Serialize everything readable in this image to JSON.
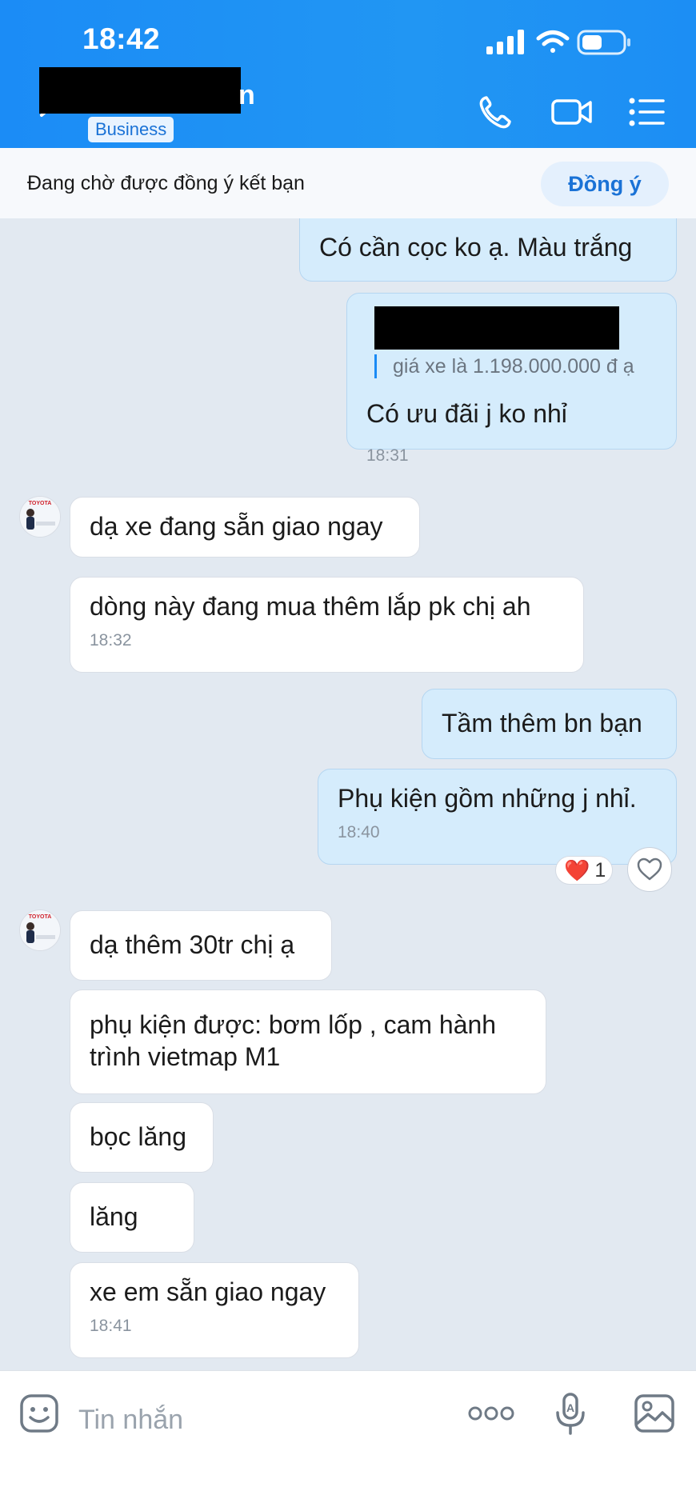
{
  "status_bar": {
    "time": "18:42"
  },
  "header": {
    "name_visible_tail": "n",
    "badge": "Business",
    "icons": [
      "phone-icon",
      "video-call-icon",
      "menu-list-icon"
    ],
    "background": "#2196f3"
  },
  "friend_request": {
    "text": "Đang chờ được đồng ý kết bạn",
    "accept_label": "Đồng ý"
  },
  "messages": [
    {
      "dir": "out",
      "text": "Có cần cọc ko ạ. Màu trắng",
      "time": ""
    },
    {
      "dir": "out",
      "quote": "giá xe là 1.198.000.000 đ ạ",
      "text": "Có ưu đãi j ko nhỉ",
      "time": "18:31"
    },
    {
      "dir": "in",
      "text": "dạ xe đang sẵn giao ngay",
      "time": ""
    },
    {
      "dir": "in",
      "text": "dòng này đang mua thêm lắp pk chị ah",
      "time": "18:32"
    },
    {
      "dir": "out",
      "text": "Tầm thêm bn bạn",
      "time": ""
    },
    {
      "dir": "out",
      "text": "Phụ kiện gồm những j nhỉ.",
      "time": "18:40",
      "reaction": {
        "emoji": "❤️",
        "count": "1"
      }
    },
    {
      "dir": "in",
      "text": "dạ thêm 30tr chị ạ",
      "time": ""
    },
    {
      "dir": "in",
      "text": "phụ kiện được: bơm lốp , cam hành trình vietmap M1",
      "time": ""
    },
    {
      "dir": "in",
      "text": "bọc lăng",
      "time": ""
    },
    {
      "dir": "in",
      "text": "lăng",
      "time": ""
    },
    {
      "dir": "in",
      "text": "xe em sẵn giao ngay",
      "time": "18:41"
    }
  ],
  "avatar_label": "TOYOTA",
  "composer": {
    "placeholder": "Tin nhắn",
    "icons": [
      "sticker-icon",
      "more-icon",
      "voice-to-text-icon",
      "image-icon"
    ]
  },
  "colors": {
    "accent": "#1a8af5",
    "outgoing_bubble": "#d5ecfc",
    "incoming_bubble": "#ffffff",
    "chat_background": "#e2e9f1",
    "heart": "#e8212d"
  }
}
